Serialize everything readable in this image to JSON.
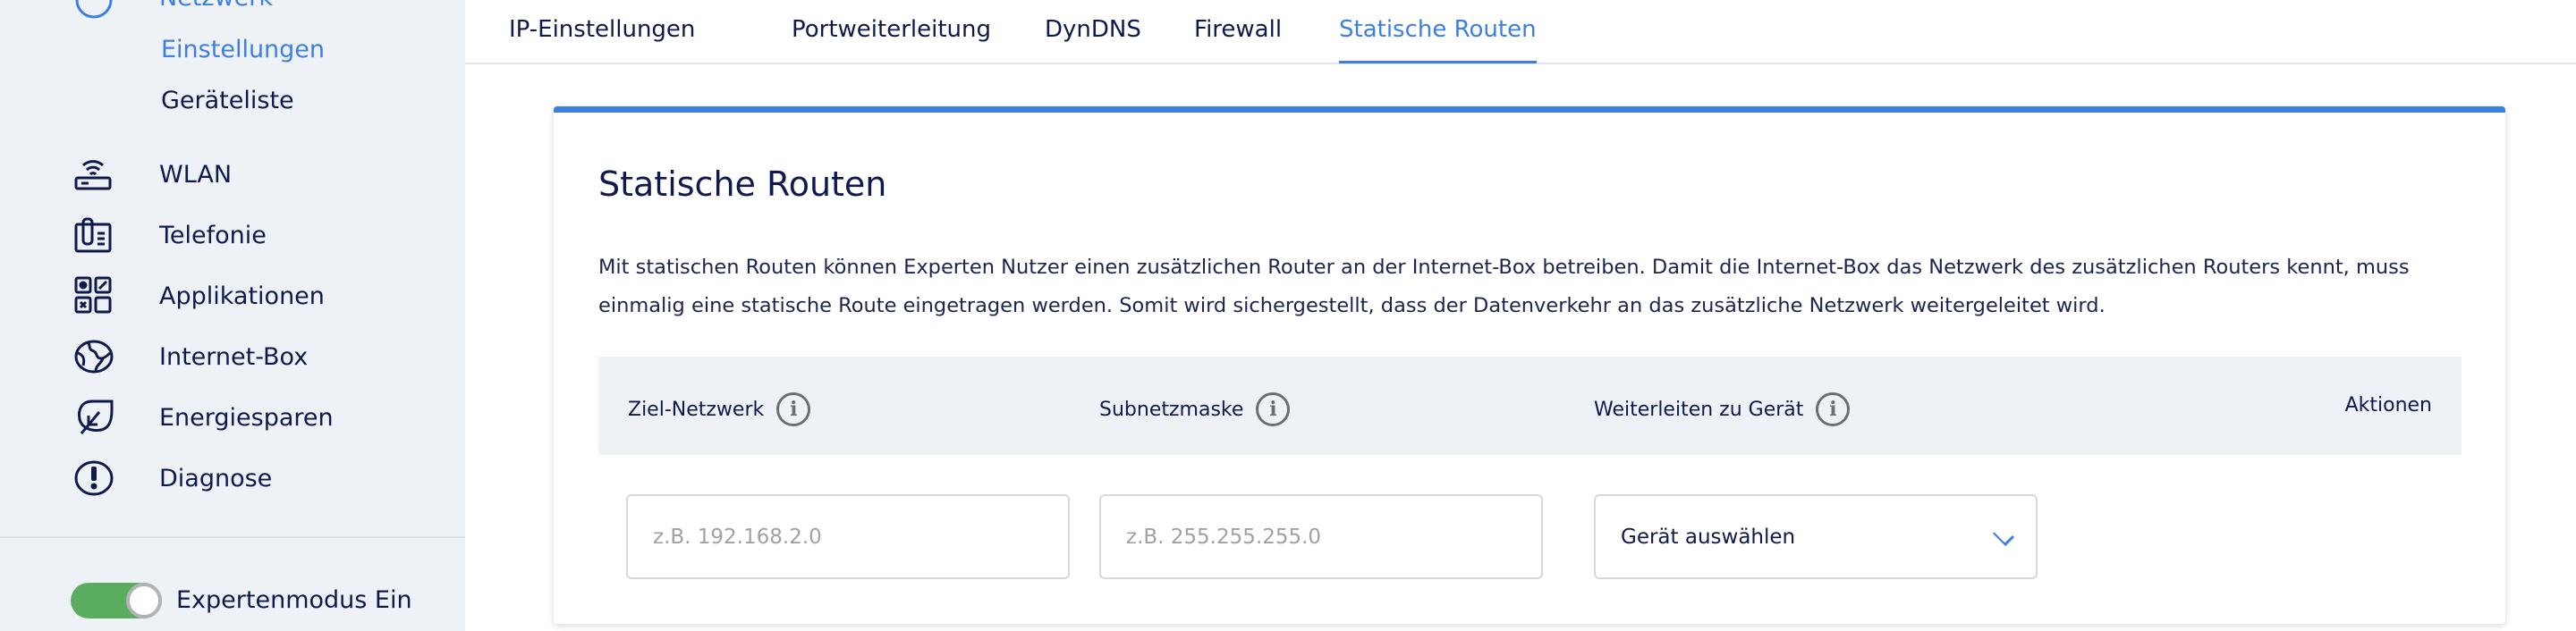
{
  "sidebar": {
    "section": "Netzwerk",
    "sub_items": [
      {
        "label": "Einstellungen",
        "active": true
      },
      {
        "label": "Geräteliste",
        "active": false
      }
    ],
    "items": [
      {
        "label": "WLAN",
        "icon": "router-wifi-icon"
      },
      {
        "label": "Telefonie",
        "icon": "phone-icon"
      },
      {
        "label": "Applikationen",
        "icon": "apps-grid-icon"
      },
      {
        "label": "Internet-Box",
        "icon": "globe-icon"
      },
      {
        "label": "Energiesparen",
        "icon": "leaf-icon"
      },
      {
        "label": "Diagnose",
        "icon": "exclamation-circle-icon"
      }
    ],
    "expert_mode": {
      "label": "Expertenmodus Ein",
      "on": true,
      "color": "#5aad5e"
    }
  },
  "tabs": [
    {
      "label": "IP-Einstellungen"
    },
    {
      "label": "Portweiterleitung"
    },
    {
      "label": "DynDNS"
    },
    {
      "label": "Firewall"
    },
    {
      "label": "Statische Routen",
      "active": true
    }
  ],
  "card": {
    "title": "Statische Routen",
    "description": "Mit statischen Routen können Experten Nutzer einen zusätzlichen Router an der Internet-Box betreiben. Damit die Internet-Box das Netzwerk des zusätzlichen Routers kennt, muss einmalig eine statische Route eingetragen werden. Somit wird sichergestellt, dass der Datenverkehr an das zusätzliche Netzwerk weitergeleitet wird.",
    "columns": [
      "Ziel-Netzwerk",
      "Subnetzmaske",
      "Weiterleiten zu Gerät",
      "Aktionen"
    ],
    "inputs": {
      "network_placeholder": "z.B. 192.168.2.0",
      "subnet_placeholder": "z.B. 255.255.255.0",
      "device_select": "Gerät auswählen"
    }
  },
  "colors": {
    "accent": "#3d7fe0",
    "text": "#0e1a4d",
    "sidebar_bg": "#eef2f6"
  }
}
